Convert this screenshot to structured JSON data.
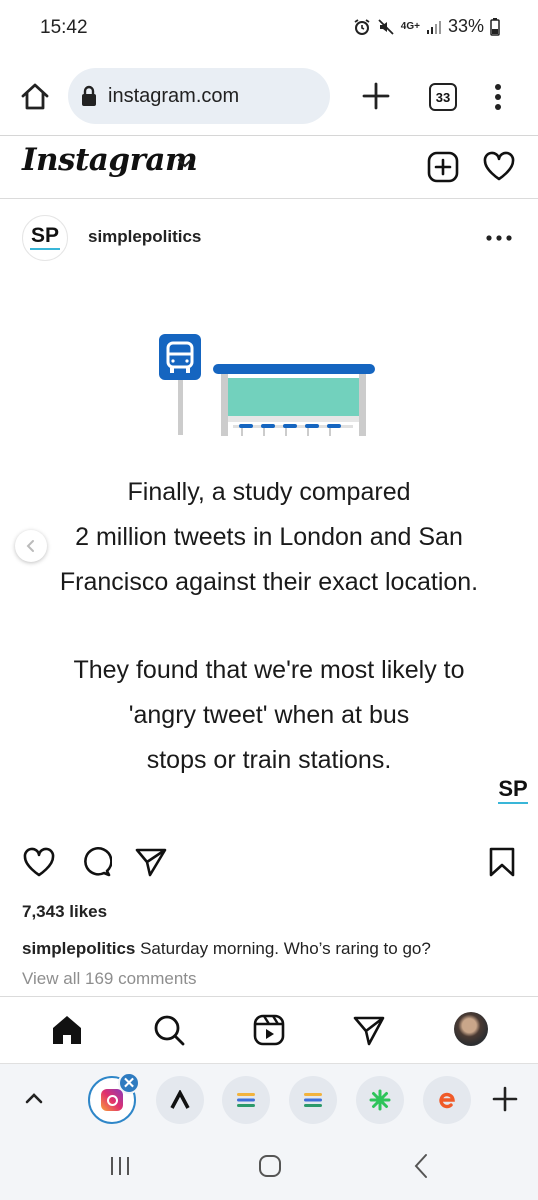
{
  "status": {
    "time": "15:42",
    "network": "4G+",
    "battery": "33%"
  },
  "browser": {
    "url": "instagram.com",
    "tab_count": "33",
    "icons": [
      "home-icon",
      "lock-icon",
      "plus-icon",
      "tabs-icon",
      "more-vert-icon"
    ]
  },
  "instagram": {
    "logo": "Instagram",
    "header_icons": [
      "chevron-down-icon",
      "create-icon",
      "heart-icon"
    ]
  },
  "post": {
    "username": "simplepolitics",
    "avatar_text": "SP",
    "image_text_1": [
      "Finally, a study compared",
      "2 million tweets in London and San",
      "Francisco against their exact location."
    ],
    "image_text_2": [
      "They found that we're most likely to",
      "'angry tweet' when at bus",
      "stops or train stations."
    ],
    "watermark": "SP",
    "likes": "7,343 likes",
    "caption_user": "simplepolitics",
    "caption_text": " Saturday morning. Who’s raring to go?",
    "view_comments": "View all 169 comments"
  },
  "ig_nav": [
    "home-icon",
    "search-icon",
    "reels-icon",
    "direct-icon",
    "profile-avatar"
  ],
  "tab_strip": {
    "tiles": [
      "instagram",
      "arrow-up-logo",
      "list-icon",
      "list-icon",
      "clover-icon",
      "e-logo"
    ]
  },
  "colors": {
    "accent_blue": "#1565c0",
    "shelter_teal": "#72d1bd",
    "sp_underline": "#39b6d8"
  }
}
